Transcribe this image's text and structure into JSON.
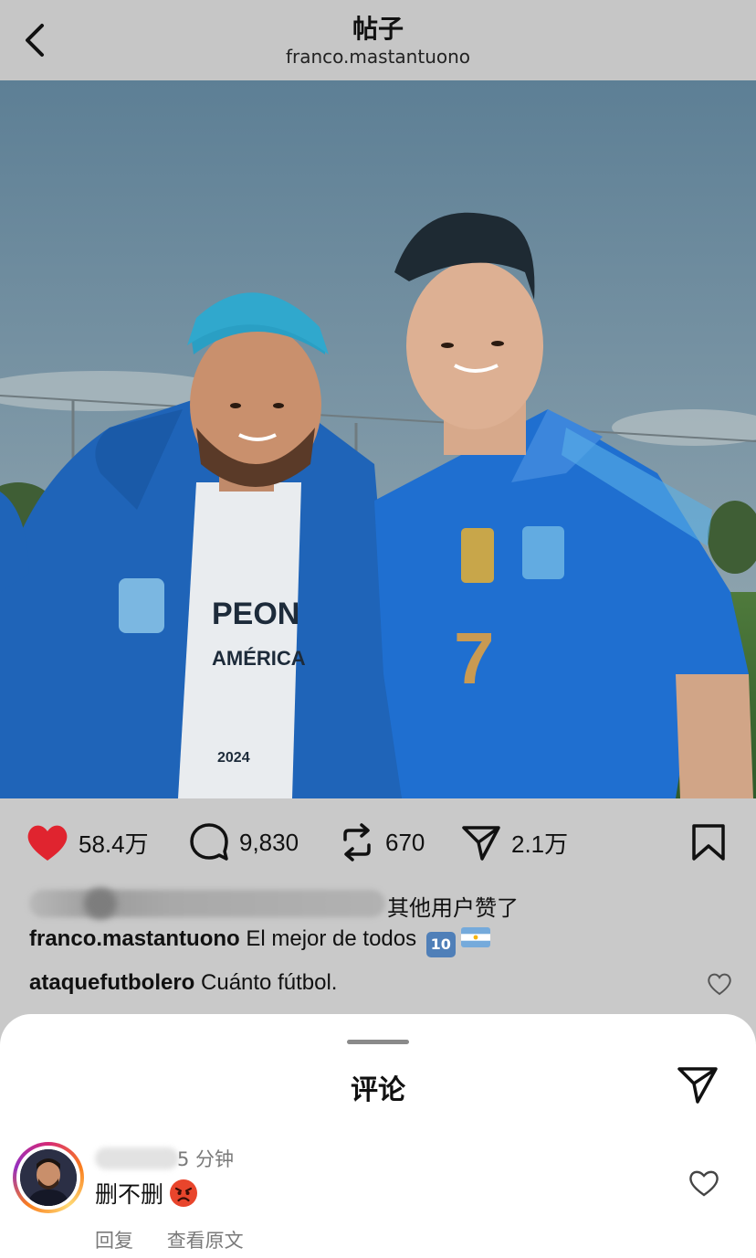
{
  "header": {
    "title": "帖子",
    "username": "franco.mastantuono"
  },
  "post": {
    "likes_count": "58.4万",
    "comments_count": "9,830",
    "reposts_count": "670",
    "shares_count": "2.1万",
    "liked_by_suffix": "其他用户赞了",
    "caption_user": "franco.mastantuono",
    "caption_text": " El mejor de todos ",
    "caption_emoji": "10",
    "preview_comment_user": "ataquefutbolero",
    "preview_comment_text": " Cuánto fútbol."
  },
  "sheet": {
    "title": "评论",
    "comment": {
      "time": "5 分钟",
      "text": "删不删",
      "reply_label": "回复",
      "translate_label": "查看原文"
    }
  },
  "colors": {
    "like_red": "#e0242f",
    "header_bg": "#c6c6c6",
    "sheet_bg": "#ffffff"
  },
  "icons": [
    "back-icon",
    "heart-icon",
    "comment-icon",
    "repost-icon",
    "send-icon",
    "bookmark-icon",
    "heart-outline-icon"
  ]
}
